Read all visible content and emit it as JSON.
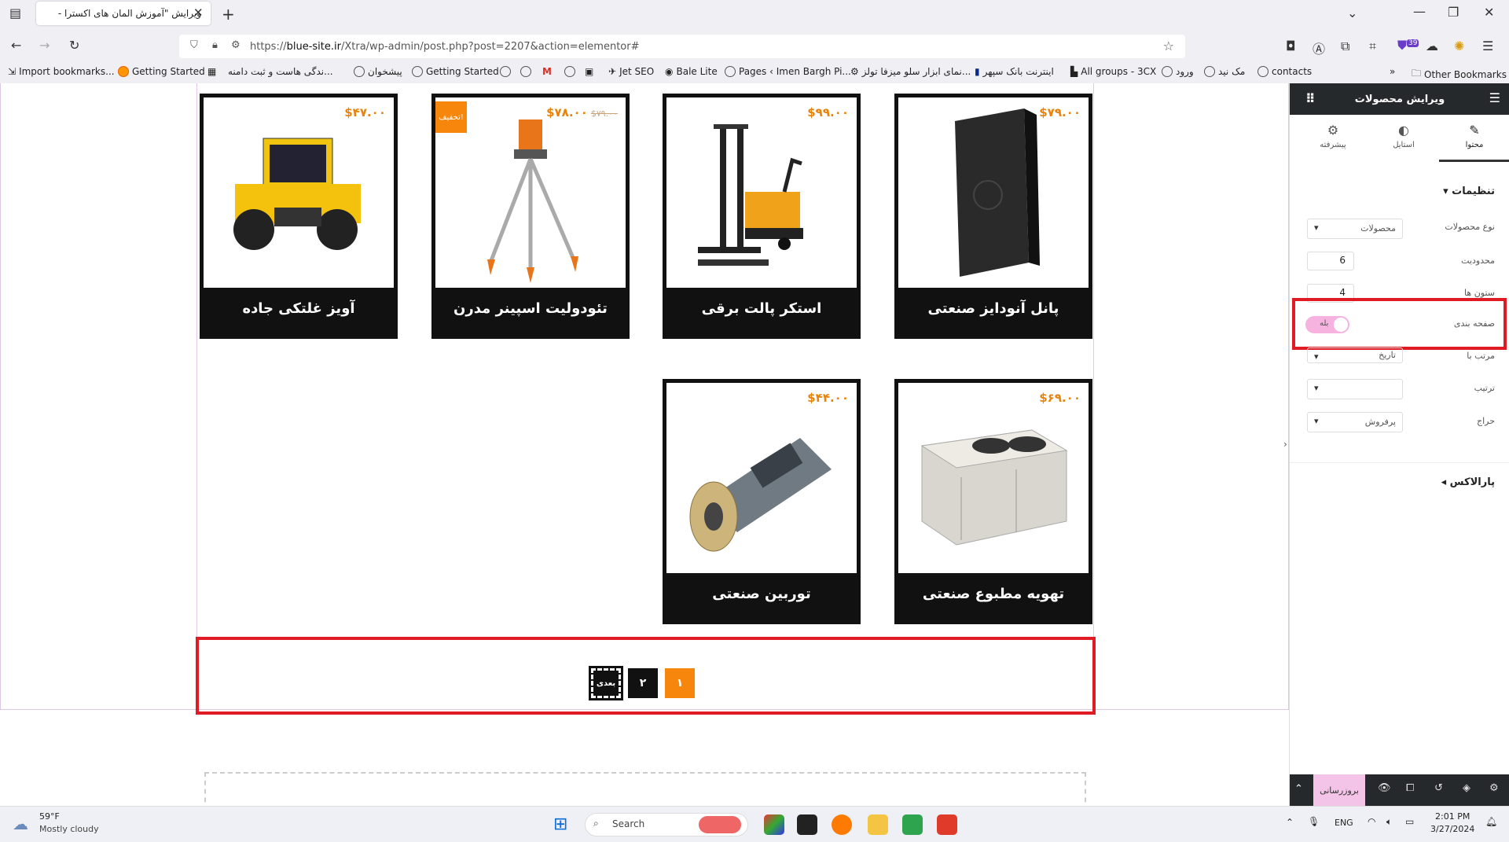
{
  "browser": {
    "tab_title": "ویرایش \"آموزش المان های اکسترا - ...",
    "url_prefix": "https://",
    "url_host": "blue-site.ir",
    "url_path": "/Xtra/wp-admin/post.php?post=2207&action=elementor#",
    "bookmarks": [
      "Import bookmarks...",
      "Getting Started",
      "...ندگی هاست و ثبت دامنه",
      "پیشخوان",
      "Getting Started",
      "Jet SEO",
      "Bale Lite",
      "Pages ‹ Imen Bargh Pi...",
      "...نمای ابزار سلو میزفا تولز",
      "اینترنت بانک سپهر",
      "All groups - 3CX",
      "ورود",
      "مک نید",
      "contacts",
      "Other Bookmarks"
    ],
    "extension_badge": "39"
  },
  "products": [
    {
      "name": "پانل آنودایز صنعتی",
      "price": "$۷۹.۰۰",
      "old_price": "",
      "sale": ""
    },
    {
      "name": "استکر پالت برقی",
      "price": "$۹۹.۰۰",
      "old_price": "",
      "sale": ""
    },
    {
      "name": "تئودولیت اسپینر مدرن",
      "price": "$۷۸.۰۰",
      "old_price": "$۷۹.۰۰",
      "sale": "تخفیف!"
    },
    {
      "name": "آویز غلتکی جاده",
      "price": "$۴۷.۰۰",
      "old_price": "",
      "sale": ""
    },
    {
      "name": "تهویه مطبوع صنعتی",
      "price": "$۶۹.۰۰",
      "old_price": "",
      "sale": ""
    },
    {
      "name": "توربین صنعتی",
      "price": "$۴۴.۰۰",
      "old_price": "",
      "sale": ""
    }
  ],
  "pagination": {
    "pages": [
      "۱",
      "۲"
    ],
    "next_label": "بعدی"
  },
  "panel": {
    "title": "ویرایش محصولات",
    "tabs": [
      {
        "label": "محتوا"
      },
      {
        "label": "استایل"
      },
      {
        "label": "پیشرفته"
      }
    ],
    "section_settings": "تنظیمات",
    "fields": {
      "product_type_label": "نوع محصولات",
      "product_type_value": "محصولات",
      "limit_label": "محدودیت",
      "limit_value": "6",
      "columns_label": "ستون ها",
      "columns_value": "4",
      "pagination_label": "صفحه بندی",
      "pagination_toggle": "بله",
      "orderby_label": "مرتب با",
      "orderby_value": "تاریخ",
      "order_label": "ترتیب",
      "order_value": "",
      "sale_label": "حراج",
      "sale_value": "پرفروش"
    },
    "section_parallax": "پارالاکس",
    "update_button": "بروزرسانی"
  },
  "taskbar": {
    "weather_temp": "59°F",
    "weather_desc": "Mostly cloudy",
    "search_placeholder": "Search",
    "lang": "ENG",
    "time": "2:01 PM",
    "date": "3/27/2024"
  }
}
